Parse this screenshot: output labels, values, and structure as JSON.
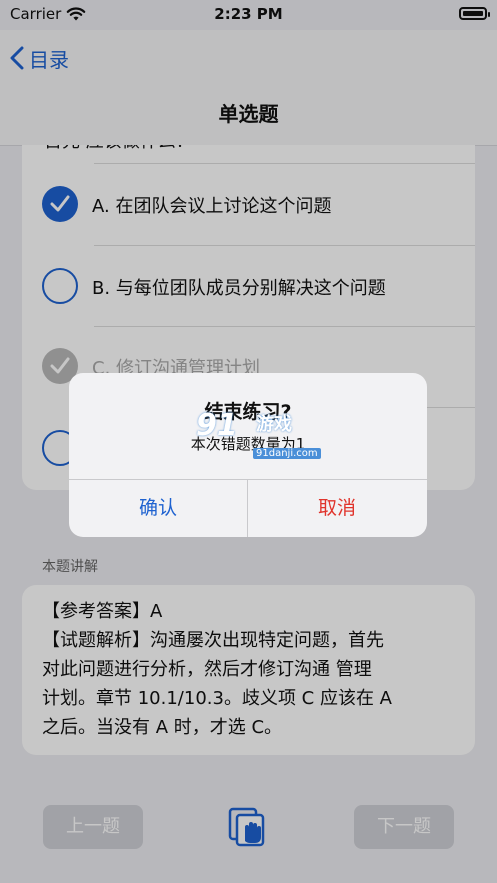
{
  "status_bar": {
    "carrier": "Carrier",
    "time": "2:23 PM"
  },
  "nav": {
    "back_label": "目录",
    "title": "单选题"
  },
  "question": {
    "partial_text": "首先 应该做什么？",
    "options": [
      {
        "label": "A. 在团队会议上讨论这个问题",
        "state": "selected"
      },
      {
        "label": "B. 与每位团队成员分别解决这个问题",
        "state": "unselected"
      },
      {
        "label": "C. 修订沟通管理计划",
        "state": "correct-dimmed"
      },
      {
        "label": "",
        "state": "unselected"
      }
    ]
  },
  "explanation": {
    "section_label": "本题讲解",
    "lines": [
      "【参考答案】A",
      "【试题解析】沟通屡次出现特定问题，首先",
      "对此问题进行分析，然后才修订沟通 管理",
      "计划。章节 10.1/10.3。歧义项 C 应该在 A",
      "之后。当没有 A 时，才选 C。"
    ]
  },
  "toolbar": {
    "prev_label": "上一题",
    "next_label": "下一题"
  },
  "alert": {
    "title": "结束练习?",
    "message": "本次错题数量为1",
    "confirm_label": "确认",
    "cancel_label": "取消"
  },
  "watermark": {
    "brand": "91",
    "text": "游戏",
    "url": "91danji.com"
  },
  "colors": {
    "accent": "#1e62d0",
    "destructive": "#e0342c",
    "disabled_button": "#cfd0d6"
  }
}
